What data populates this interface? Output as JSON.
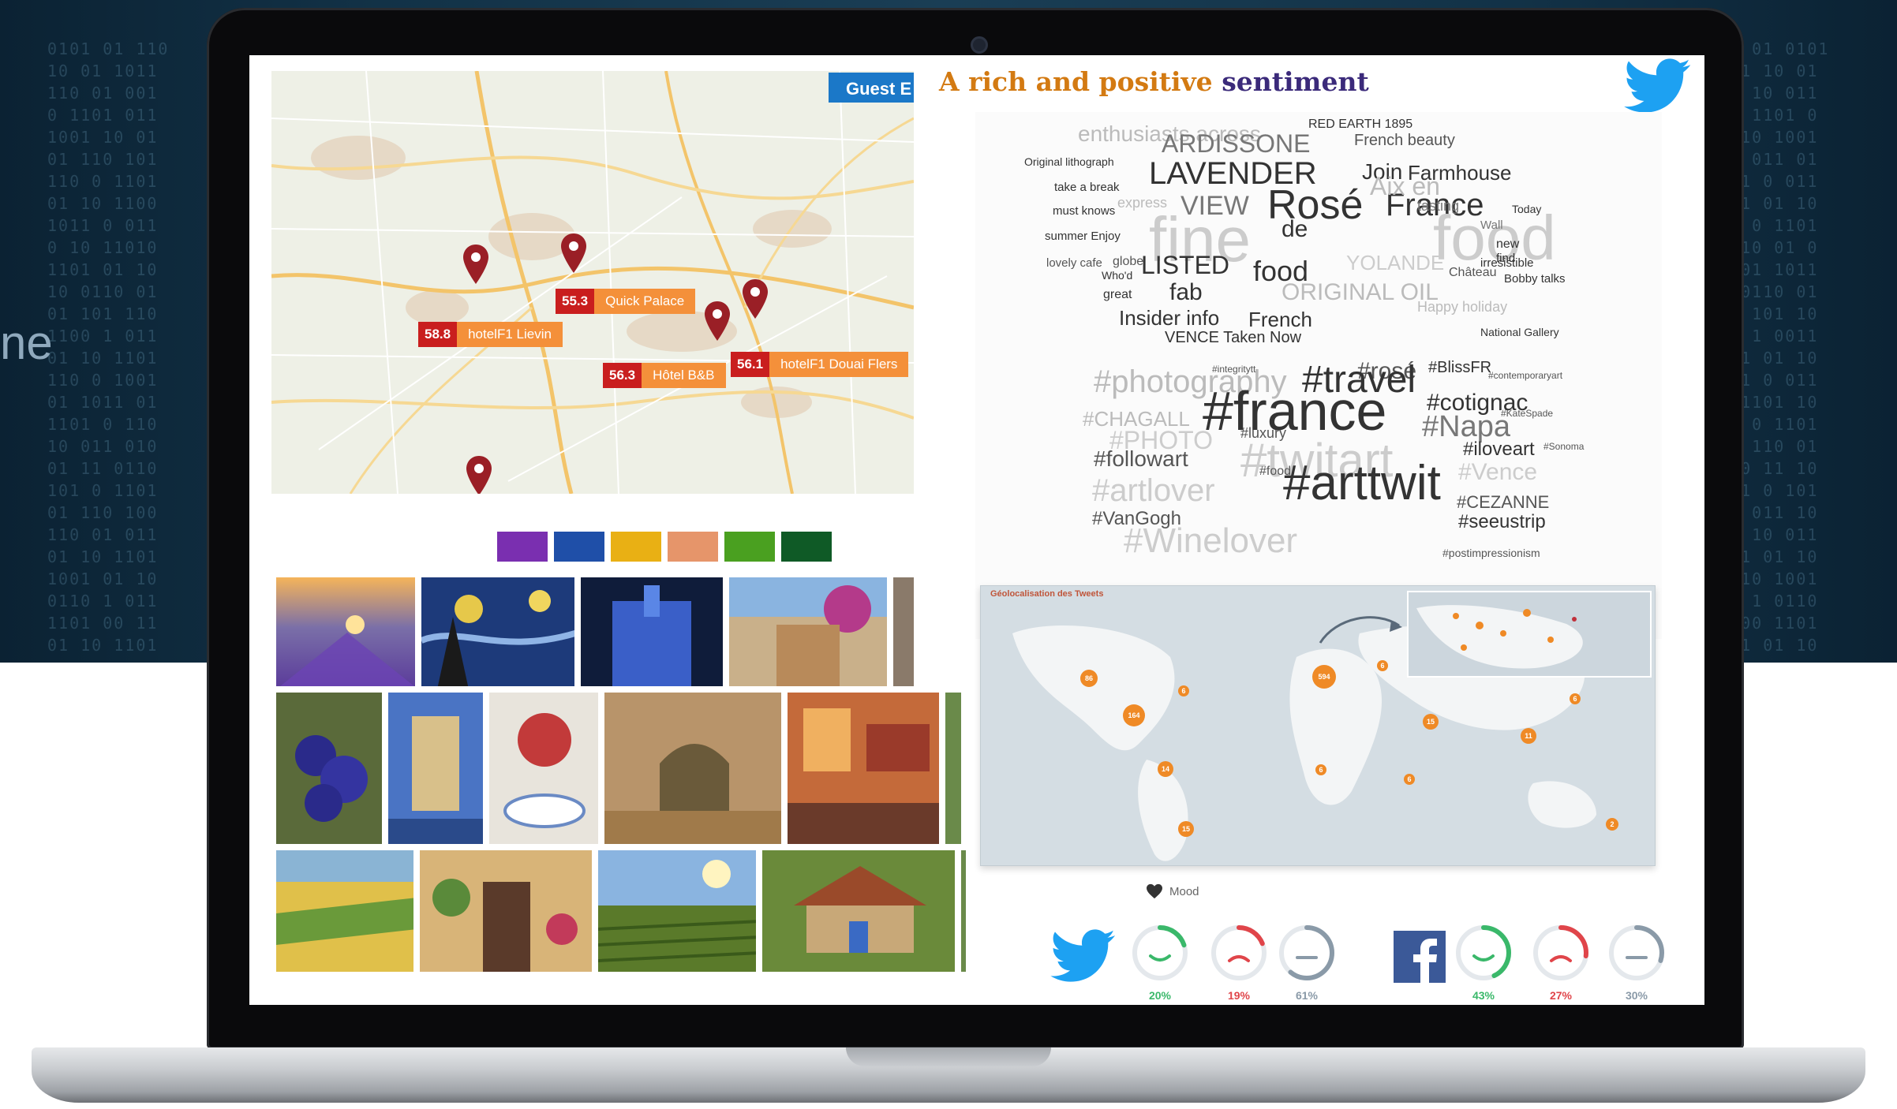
{
  "background": {
    "partial_text": "ne"
  },
  "map": {
    "guest_button": "Guest E",
    "hotels": [
      {
        "price": "55.3",
        "name": "Quick Palace"
      },
      {
        "price": "58.8",
        "name": "hotelF1 Lievin"
      },
      {
        "price": "56.3",
        "name": "Hôtel B&B"
      },
      {
        "price": "56.1",
        "name": "hotelF1 Douai Flers"
      }
    ]
  },
  "swatch_colors": [
    "#7a2fb0",
    "#1f4fa8",
    "#e9b014",
    "#e6956a",
    "#4aa020",
    "#0f5a26"
  ],
  "title": {
    "part1": "A rich and positive",
    "part2": "sentiment"
  },
  "wordcloud": {
    "words": [
      {
        "t": "enthusiasts across",
        "c": "#bbbbbb",
        "s": 28
      },
      {
        "t": "ARDISSONE",
        "c": "#777777",
        "s": 32
      },
      {
        "t": "French beauty",
        "c": "#555555",
        "s": 20
      },
      {
        "t": "RED EARTH 1895",
        "c": "#333333",
        "s": 16
      },
      {
        "t": "LAVENDER",
        "c": "#333333",
        "s": 40
      },
      {
        "t": "Join",
        "c": "#333333",
        "s": 28
      },
      {
        "t": "Farmhouse",
        "c": "#333333",
        "s": 26
      },
      {
        "t": "Rosé",
        "c": "#333333",
        "s": 52
      },
      {
        "t": "France",
        "c": "#333333",
        "s": 40
      },
      {
        "t": "VIEW",
        "c": "#777777",
        "s": 34
      },
      {
        "t": "Aix en",
        "c": "#bbbbbb",
        "s": 32
      },
      {
        "t": "fine",
        "c": "#cccccc",
        "s": 80
      },
      {
        "t": "food",
        "c": "#cccccc",
        "s": 80
      },
      {
        "t": "de",
        "c": "#333333",
        "s": 30
      },
      {
        "t": "LISTED",
        "c": "#333333",
        "s": 32
      },
      {
        "t": "food",
        "c": "#333333",
        "s": 36
      },
      {
        "t": "YOLANDE",
        "c": "#cccccc",
        "s": 26
      },
      {
        "t": "fab",
        "c": "#333333",
        "s": 30
      },
      {
        "t": "ORIGINAL OIL",
        "c": "#bbbbbb",
        "s": 30
      },
      {
        "t": "Insider info",
        "c": "#333333",
        "s": 26
      },
      {
        "t": "French",
        "c": "#333333",
        "s": 26
      },
      {
        "t": "Happy holiday",
        "c": "#bbbbbb",
        "s": 18
      },
      {
        "t": "VENCE Taken Now",
        "c": "#333333",
        "s": 20
      },
      {
        "t": "#photography",
        "c": "#bbbbbb",
        "s": 40
      },
      {
        "t": "#rosé",
        "c": "#555555",
        "s": 30
      },
      {
        "t": "#BlissFR",
        "c": "#333333",
        "s": 20
      },
      {
        "t": "#travel",
        "c": "#333333",
        "s": 48
      },
      {
        "t": "#cotignac",
        "c": "#333333",
        "s": 30
      },
      {
        "t": "#france",
        "c": "#333333",
        "s": 70
      },
      {
        "t": "#Napa",
        "c": "#777777",
        "s": 38
      },
      {
        "t": "#CHAGALL",
        "c": "#bbbbbb",
        "s": 26
      },
      {
        "t": "#PHOTO",
        "c": "#cccccc",
        "s": 32
      },
      {
        "t": "#luxury",
        "c": "#555555",
        "s": 18
      },
      {
        "t": "#twitart",
        "c": "#cccccc",
        "s": 60
      },
      {
        "t": "#iloveart",
        "c": "#333333",
        "s": 24
      },
      {
        "t": "#followart",
        "c": "#555555",
        "s": 28
      },
      {
        "t": "#Vence",
        "c": "#cccccc",
        "s": 30
      },
      {
        "t": "#artlover",
        "c": "#cccccc",
        "s": 40
      },
      {
        "t": "#food",
        "c": "#555555",
        "s": 16
      },
      {
        "t": "#arttwit",
        "c": "#333333",
        "s": 62
      },
      {
        "t": "#CEZANNE",
        "c": "#555555",
        "s": 22
      },
      {
        "t": "#VanGogh",
        "c": "#555555",
        "s": 24
      },
      {
        "t": "#seeustrip",
        "c": "#333333",
        "s": 24
      },
      {
        "t": "#Winelover",
        "c": "#cccccc",
        "s": 44
      },
      {
        "t": "#postimpressionism",
        "c": "#555555",
        "s": 14
      },
      {
        "t": "National Gallery",
        "c": "#333333",
        "s": 14
      },
      {
        "t": "Original lithograph",
        "c": "#333333",
        "s": 14
      },
      {
        "t": "take a break",
        "c": "#333333",
        "s": 15
      },
      {
        "t": "must knows",
        "c": "#333333",
        "s": 15
      },
      {
        "t": "summer Enjoy",
        "c": "#333333",
        "s": 15
      },
      {
        "t": "lovely cafe",
        "c": "#555555",
        "s": 15
      },
      {
        "t": "globe",
        "c": "#555555",
        "s": 16
      },
      {
        "t": "Bobby talks",
        "c": "#333333",
        "s": 15
      },
      {
        "t": "Château",
        "c": "#555555",
        "s": 16
      },
      {
        "t": "irresistible",
        "c": "#333333",
        "s": 15
      },
      {
        "t": "tasting",
        "c": "#777777",
        "s": 18
      },
      {
        "t": "Today",
        "c": "#333333",
        "s": 14
      },
      {
        "t": "express",
        "c": "#bbbbbb",
        "s": 18
      },
      {
        "t": "new",
        "c": "#333333",
        "s": 16
      },
      {
        "t": "find",
        "c": "#333333",
        "s": 15
      },
      {
        "t": "Wall",
        "c": "#777777",
        "s": 15
      },
      {
        "t": "great",
        "c": "#333333",
        "s": 16
      },
      {
        "t": "Who'd",
        "c": "#333333",
        "s": 14
      },
      {
        "t": "#contemporaryart",
        "c": "#555555",
        "s": 12
      },
      {
        "t": "#KateSpade",
        "c": "#555555",
        "s": 12
      },
      {
        "t": "#Sonoma",
        "c": "#555555",
        "s": 12
      },
      {
        "t": "#integritytt",
        "c": "#555555",
        "s": 12
      }
    ]
  },
  "worldmap": {
    "title": "Géolocalisation des Tweets",
    "bubbles": [
      "86",
      "6",
      "164",
      "14",
      "6",
      "15",
      "594",
      "6",
      "15",
      "11",
      "6",
      "6",
      "2"
    ]
  },
  "mood": {
    "label": "Mood",
    "twitter": [
      {
        "kind": "positive",
        "pct": "20%",
        "color": "#3ab86a"
      },
      {
        "kind": "negative",
        "pct": "19%",
        "color": "#e0454a"
      },
      {
        "kind": "neutral",
        "pct": "61%",
        "color": "#8a9aa8"
      }
    ],
    "facebook": [
      {
        "kind": "positive",
        "pct": "43%",
        "color": "#3ab86a"
      },
      {
        "kind": "negative",
        "pct": "27%",
        "color": "#e0454a"
      },
      {
        "kind": "neutral",
        "pct": "30%",
        "color": "#8a9aa8"
      }
    ]
  }
}
